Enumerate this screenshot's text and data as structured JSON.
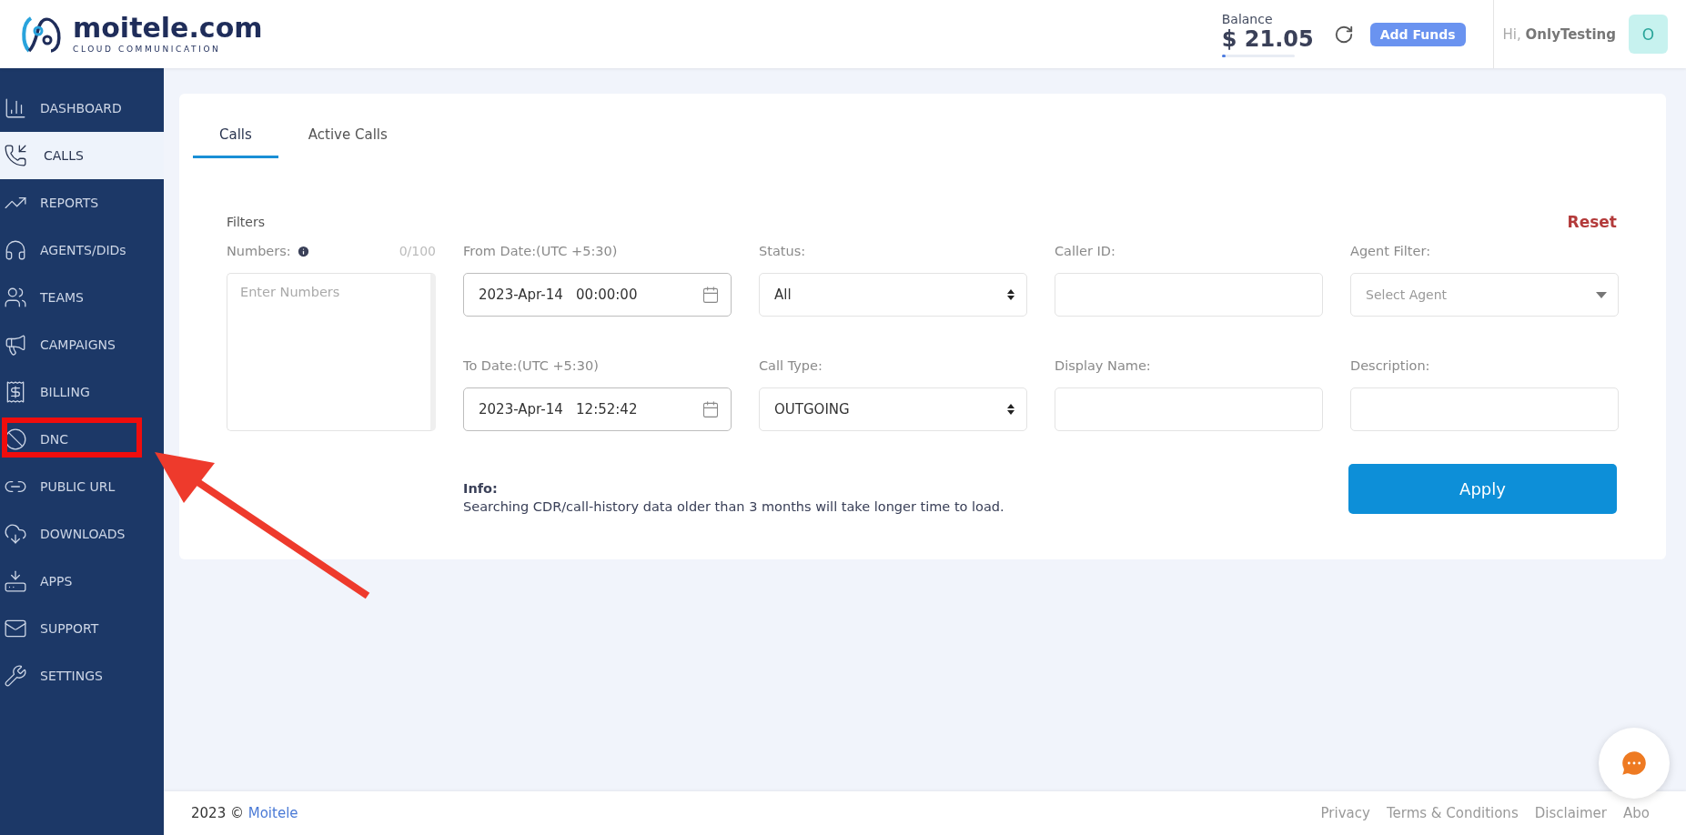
{
  "header": {
    "logo_name": "moitele.com",
    "logo_tagline": "CLOUD COMMUNICATION",
    "balance_label": "Balance",
    "balance_amount": "$ 21.05",
    "balance_bar": {
      "level": 0.05
    },
    "add_funds": "Add Funds",
    "greeting": "Hi, **OnlyTesting**",
    "avatar": "O"
  },
  "sidebar": {
    "items": [
      {
        "label": "DASHBOARD",
        "selected": false,
        "highlighted": false
      },
      {
        "label": "CALLS",
        "selected": true,
        "highlighted": false
      },
      {
        "label": "REPORTS",
        "selected": false,
        "highlighted": false
      },
      {
        "label": "AGENTS/DIDs",
        "selected": false,
        "highlighted": false
      },
      {
        "label": "TEAMS",
        "selected": false,
        "highlighted": false
      },
      {
        "label": "CAMPAIGNS",
        "selected": false,
        "highlighted": false
      },
      {
        "label": "BILLING",
        "selected": false,
        "highlighted": false
      },
      {
        "label": "DNC",
        "selected": false,
        "highlighted": true
      },
      {
        "label": "PUBLIC URL",
        "selected": false,
        "highlighted": false
      },
      {
        "label": "DOWNLOADS",
        "selected": false,
        "highlighted": false
      },
      {
        "label": "APPS",
        "selected": false,
        "highlighted": false
      },
      {
        "label": "SUPPORT",
        "selected": false,
        "highlighted": false
      },
      {
        "label": "SETTINGS",
        "selected": false,
        "highlighted": false
      }
    ]
  },
  "tabs": [
    {
      "label": "Calls",
      "selected": true
    },
    {
      "label": "Active Calls",
      "selected": false
    }
  ],
  "filters": {
    "title": "Filters",
    "reset": "Reset",
    "fields": [
      {
        "kind": "textarea",
        "label": "Numbers:",
        "counter": "0/100",
        "placeholder": "Enter Numbers"
      },
      {
        "kind": "date",
        "label": "From Date:(UTC +5:30)",
        "value": "2023-Apr-14   00:00:00"
      },
      {
        "kind": "select",
        "label": "Status:",
        "value": "All"
      },
      {
        "kind": "text",
        "label": "Caller ID:"
      },
      {
        "kind": "combo",
        "label": "Agent Filter:",
        "placeholder": "Select Agent"
      },
      {
        "kind": "date",
        "label": "To Date:(UTC +5:30)",
        "value": "2023-Apr-14   12:52:42"
      },
      {
        "kind": "select",
        "label": "Call Type:",
        "value": "OUTGOING"
      },
      {
        "kind": "text",
        "label": "Display Name:"
      },
      {
        "kind": "text",
        "label": "Description:"
      }
    ],
    "info_title": "Info:",
    "info_text": "Searching CDR/call-history data older than 3 months will take longer time to load.",
    "apply": "Apply"
  },
  "footer": {
    "year": "2023 ©",
    "brand": "Moitele",
    "links": [
      "Privacy",
      "Terms & Conditions",
      "Disclaimer",
      "Abo"
    ]
  }
}
